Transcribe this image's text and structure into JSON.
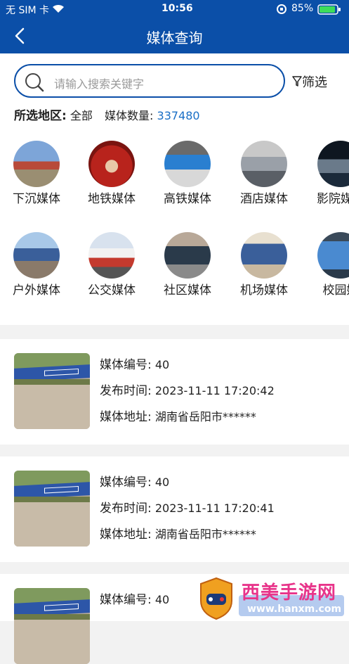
{
  "status_bar": {
    "carrier": "无 SIM 卡",
    "time": "10:56",
    "battery": "85%"
  },
  "nav": {
    "title": "媒体查询"
  },
  "search": {
    "placeholder": "请输入搜索关键字",
    "filter_label": "筛选"
  },
  "region": {
    "label": "所选地区:",
    "value": "全部",
    "count_label": "媒体数量:",
    "count": "337480"
  },
  "categories": [
    {
      "label": "下沉媒体",
      "icon": "sinking-media-icon",
      "color": "#c44a3a"
    },
    {
      "label": "地铁媒体",
      "icon": "subway-media-icon",
      "color": "#b8231c"
    },
    {
      "label": "高铁媒体",
      "icon": "highspeed-rail-media-icon",
      "color": "#2a7fd0"
    },
    {
      "label": "酒店媒体",
      "icon": "hotel-media-icon",
      "color": "#8a8f96"
    },
    {
      "label": "影院媒体",
      "icon": "cinema-media-icon",
      "color": "#1b2a3a"
    },
    {
      "label": "户外媒体",
      "icon": "outdoor-media-icon",
      "color": "#5f89b8"
    },
    {
      "label": "公交媒体",
      "icon": "bus-media-icon",
      "color": "#c43a2e"
    },
    {
      "label": "社区媒体",
      "icon": "community-media-icon",
      "color": "#4a5a6a"
    },
    {
      "label": "机场媒体",
      "icon": "airport-media-icon",
      "color": "#3a5f9a"
    },
    {
      "label": "校园媒",
      "icon": "campus-media-icon",
      "color": "#2f6da8"
    }
  ],
  "field_labels": {
    "code": "媒体编号:",
    "time": "发布时间:",
    "address": "媒体地址:"
  },
  "media_list": [
    {
      "code": "40",
      "time": "2023-11-11 17:20:42",
      "address": "湖南省岳阳市******"
    },
    {
      "code": "40",
      "time": "2023-11-11 17:20:41",
      "address": "湖南省岳阳市******"
    },
    {
      "code": "40",
      "time": "",
      "address": ""
    }
  ],
  "watermark": {
    "text": "西美手游网",
    "sub": "www.hanxm.com"
  }
}
